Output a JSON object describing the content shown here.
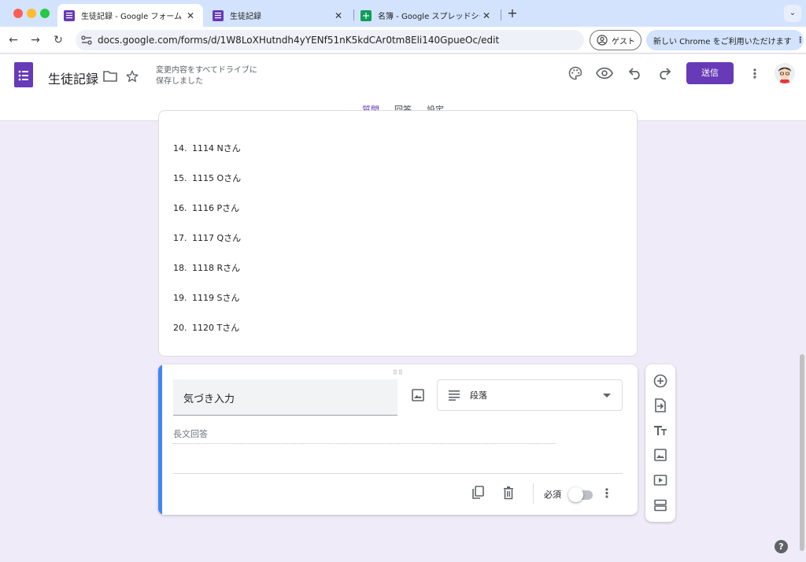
{
  "browser": {
    "tabs": [
      {
        "title": "生徒記録 - Google フォーム",
        "active": true,
        "icon": "google-forms-icon"
      },
      {
        "title": "生徒記録",
        "active": false,
        "icon": "google-forms-icon"
      },
      {
        "title": "名簿 - Google スプレッドシート",
        "active": false,
        "icon": "google-sheets-icon"
      }
    ],
    "url": "docs.google.com/forms/d/1W8LoXHutndh4yYENf51nK5kdCAr0tm8Eli140GpueOc/edit",
    "guest_label": "ゲスト",
    "chrome_banner": "新しい Chrome をご利用いただけます",
    "colors": {
      "tabbar": "#d3e3fd",
      "forms_purple": "#673ab7",
      "sheets_green": "#0f9d58"
    }
  },
  "header": {
    "doc_title": "生徒記録",
    "save_status": "変更内容をすべてドライブに保存しました",
    "send_label": "送信",
    "tabs": [
      {
        "label": "質問",
        "active": true
      },
      {
        "label": "回答",
        "active": false
      },
      {
        "label": "設定",
        "active": false
      }
    ]
  },
  "options_list": [
    {
      "num": "14.",
      "label": "1114 Nさん"
    },
    {
      "num": "15.",
      "label": "1115 Oさん"
    },
    {
      "num": "16.",
      "label": "1116 Pさん"
    },
    {
      "num": "17.",
      "label": "1117 Qさん"
    },
    {
      "num": "18.",
      "label": "1118 Rさん"
    },
    {
      "num": "19.",
      "label": "1119 Sさん"
    },
    {
      "num": "20.",
      "label": "1120 Tさん"
    }
  ],
  "question": {
    "title": "気づき入力",
    "type_label": "段落",
    "answer_placeholder": "長文回答",
    "required_label": "必須",
    "required": false
  },
  "sidebar": {
    "items": [
      "add-question-icon",
      "import-questions-icon",
      "add-title-icon",
      "add-image-icon",
      "add-video-icon",
      "add-section-icon"
    ]
  },
  "help_label": "?"
}
